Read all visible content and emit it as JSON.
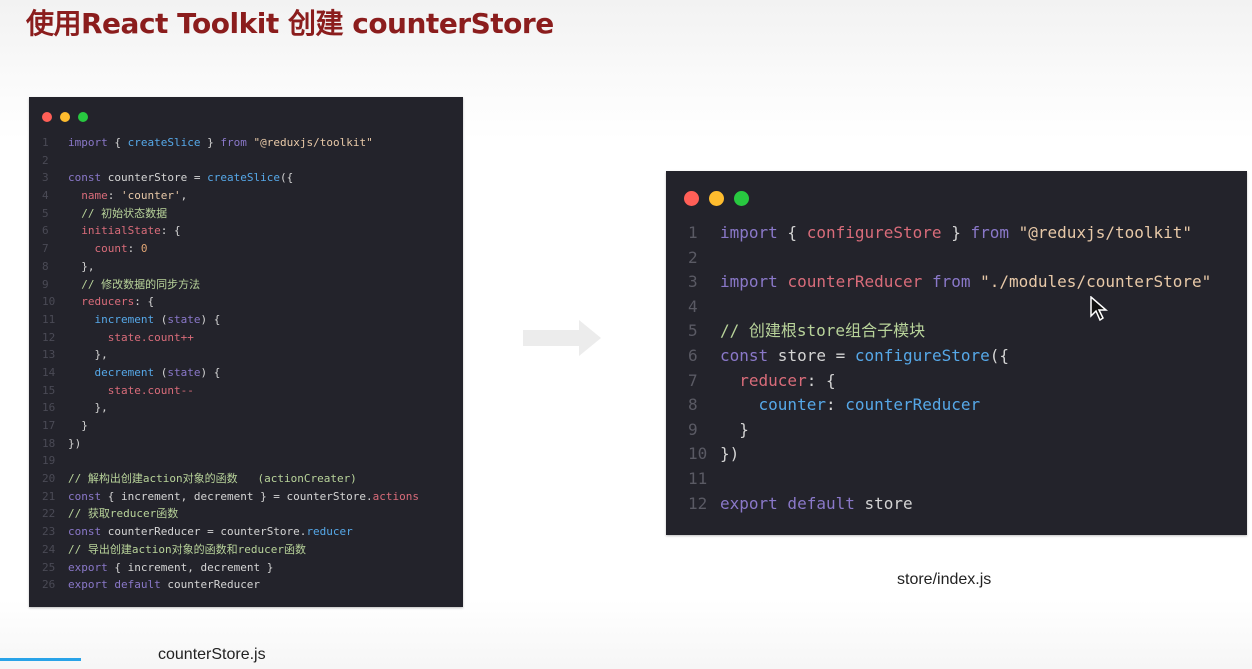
{
  "slide": {
    "title": "使用React Toolkit 创建 counterStore",
    "left_caption": "counterStore.js",
    "right_caption": "store/index.js"
  },
  "colors": {
    "keyword": "#8a78c9",
    "function": "#56a8e8",
    "string": "#e8c9a8",
    "property": "#d96c7a",
    "plain": "#d4d4d4",
    "comment": "#b8d39a",
    "number": "#e0a574"
  },
  "left_file": {
    "lines": [
      {
        "n": "1",
        "t": [
          [
            "import",
            "keyword"
          ],
          [
            " { ",
            "plain"
          ],
          [
            "createSlice",
            "function"
          ],
          [
            " } ",
            "plain"
          ],
          [
            "from",
            "keyword"
          ],
          [
            " ",
            "plain"
          ],
          [
            "\"@reduxjs/toolkit\"",
            "string"
          ]
        ]
      },
      {
        "n": "2",
        "t": []
      },
      {
        "n": "3",
        "t": [
          [
            "const",
            "keyword"
          ],
          [
            " counterStore = ",
            "plain"
          ],
          [
            "createSlice",
            "function"
          ],
          [
            "({",
            "plain"
          ]
        ]
      },
      {
        "n": "4",
        "t": [
          [
            "  name",
            "property"
          ],
          [
            ": ",
            "plain"
          ],
          [
            "'counter'",
            "string"
          ],
          [
            ",",
            "plain"
          ]
        ]
      },
      {
        "n": "5",
        "t": [
          [
            "  // 初始状态数据",
            "comment"
          ]
        ]
      },
      {
        "n": "6",
        "t": [
          [
            "  initialState",
            "property"
          ],
          [
            ": {",
            "plain"
          ]
        ]
      },
      {
        "n": "7",
        "t": [
          [
            "    count",
            "property"
          ],
          [
            ": ",
            "plain"
          ],
          [
            "0",
            "number"
          ]
        ]
      },
      {
        "n": "8",
        "t": [
          [
            "  },",
            "plain"
          ]
        ]
      },
      {
        "n": "9",
        "t": [
          [
            "  // 修改数据的同步方法",
            "comment"
          ]
        ]
      },
      {
        "n": "10",
        "t": [
          [
            "  reducers",
            "property"
          ],
          [
            ": {",
            "plain"
          ]
        ]
      },
      {
        "n": "11",
        "t": [
          [
            "    increment",
            "function"
          ],
          [
            " (",
            "plain"
          ],
          [
            "state",
            "keyword"
          ],
          [
            ") {",
            "plain"
          ]
        ]
      },
      {
        "n": "12",
        "t": [
          [
            "      state.count++",
            "property"
          ]
        ]
      },
      {
        "n": "13",
        "t": [
          [
            "    },",
            "plain"
          ]
        ]
      },
      {
        "n": "14",
        "t": [
          [
            "    decrement",
            "function"
          ],
          [
            " (",
            "plain"
          ],
          [
            "state",
            "keyword"
          ],
          [
            ") {",
            "plain"
          ]
        ]
      },
      {
        "n": "15",
        "t": [
          [
            "      state.count--",
            "property"
          ]
        ]
      },
      {
        "n": "16",
        "t": [
          [
            "    },",
            "plain"
          ]
        ]
      },
      {
        "n": "17",
        "t": [
          [
            "  }",
            "plain"
          ]
        ]
      },
      {
        "n": "18",
        "t": [
          [
            "})",
            "plain"
          ]
        ]
      },
      {
        "n": "19",
        "t": []
      },
      {
        "n": "20",
        "t": [
          [
            "// 解构出创建action对象的函数   (actionCreater)",
            "comment"
          ]
        ]
      },
      {
        "n": "21",
        "t": [
          [
            "const",
            "keyword"
          ],
          [
            " { increment, decrement } = counterStore.",
            "plain"
          ],
          [
            "actions",
            "property"
          ]
        ]
      },
      {
        "n": "22",
        "t": [
          [
            "// 获取reducer函数",
            "comment"
          ]
        ]
      },
      {
        "n": "23",
        "t": [
          [
            "const",
            "keyword"
          ],
          [
            " counterReducer = counterStore.",
            "plain"
          ],
          [
            "reducer",
            "function"
          ]
        ]
      },
      {
        "n": "24",
        "t": [
          [
            "// 导出创建action对象的函数和reducer函数",
            "comment"
          ]
        ]
      },
      {
        "n": "25",
        "t": [
          [
            "export",
            "keyword"
          ],
          [
            " { increment, decrement }",
            "plain"
          ]
        ]
      },
      {
        "n": "26",
        "t": [
          [
            "export default",
            "keyword"
          ],
          [
            " counterReducer",
            "plain"
          ]
        ]
      }
    ]
  },
  "right_file": {
    "lines": [
      {
        "n": "1",
        "t": [
          [
            "import",
            "keyword"
          ],
          [
            " { ",
            "plain"
          ],
          [
            "configureStore",
            "property"
          ],
          [
            " } ",
            "plain"
          ],
          [
            "from",
            "keyword"
          ],
          [
            " ",
            "plain"
          ],
          [
            "\"@reduxjs/toolkit\"",
            "string"
          ]
        ]
      },
      {
        "n": "2",
        "t": []
      },
      {
        "n": "3",
        "t": [
          [
            "import",
            "keyword"
          ],
          [
            " ",
            "plain"
          ],
          [
            "counterReducer",
            "property"
          ],
          [
            " ",
            "plain"
          ],
          [
            "from",
            "keyword"
          ],
          [
            " ",
            "plain"
          ],
          [
            "\"./modules/counterStore\"",
            "string"
          ]
        ]
      },
      {
        "n": "4",
        "t": []
      },
      {
        "n": "5",
        "t": [
          [
            "// 创建根store组合子模块",
            "comment"
          ]
        ]
      },
      {
        "n": "6",
        "t": [
          [
            "const",
            "keyword"
          ],
          [
            " store = ",
            "plain"
          ],
          [
            "configureStore",
            "function"
          ],
          [
            "({",
            "plain"
          ]
        ]
      },
      {
        "n": "7",
        "t": [
          [
            "  reducer",
            "property"
          ],
          [
            ": {",
            "plain"
          ]
        ]
      },
      {
        "n": "8",
        "t": [
          [
            "    counter",
            "function"
          ],
          [
            ": ",
            "plain"
          ],
          [
            "counterReducer",
            "function"
          ]
        ]
      },
      {
        "n": "9",
        "t": [
          [
            "  }",
            "plain"
          ]
        ]
      },
      {
        "n": "10",
        "t": [
          [
            "})",
            "plain"
          ]
        ]
      },
      {
        "n": "11",
        "t": []
      },
      {
        "n": "12",
        "t": [
          [
            "export default",
            "keyword"
          ],
          [
            " store",
            "plain"
          ]
        ]
      }
    ]
  }
}
